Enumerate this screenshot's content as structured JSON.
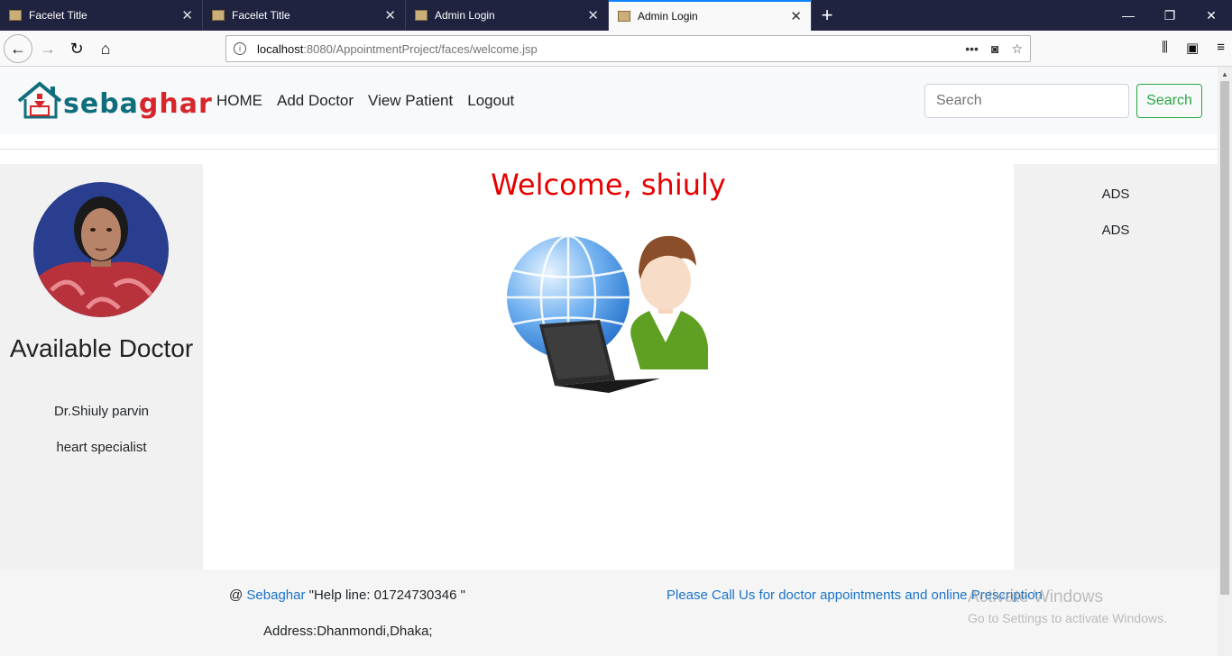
{
  "browser": {
    "tabs": [
      {
        "title": "Facelet Title",
        "active": false
      },
      {
        "title": "Facelet Title",
        "active": false
      },
      {
        "title": "Admin Login",
        "active": false
      },
      {
        "title": "Admin Login",
        "active": true
      }
    ],
    "url_host": "localhost",
    "url_path": ":8080/AppointmentProject/faces/welcome.jsp"
  },
  "site": {
    "logo": {
      "part1": "seba",
      "part2": "ghar"
    },
    "nav": [
      "HOME",
      "Add Doctor",
      "View Patient",
      "Logout"
    ],
    "search": {
      "placeholder": "Search",
      "button": "Search"
    }
  },
  "sidebar": {
    "heading": "Available Doctor",
    "doctor_name": "Dr.Shiuly parvin",
    "specialty": "heart specialist"
  },
  "main": {
    "welcome": "Welcome, shiuly"
  },
  "ads": [
    "ADS",
    "ADS"
  ],
  "footer": {
    "at": "@",
    "brand_link": "Sebaghar",
    "helpline": " \"Help line: 01724730346 \"",
    "call_text": "Please Call Us for doctor appointments and online Prescription",
    "address": "Address:Dhanmondi,Dhaka;"
  },
  "watermark": {
    "line1": "Activate Windows",
    "line2": "Go to Settings to activate Windows."
  },
  "colors": {
    "welcome": "#e60000",
    "link": "#1a73c8",
    "search_button": "#28a745",
    "tab_strip": "#202340"
  }
}
